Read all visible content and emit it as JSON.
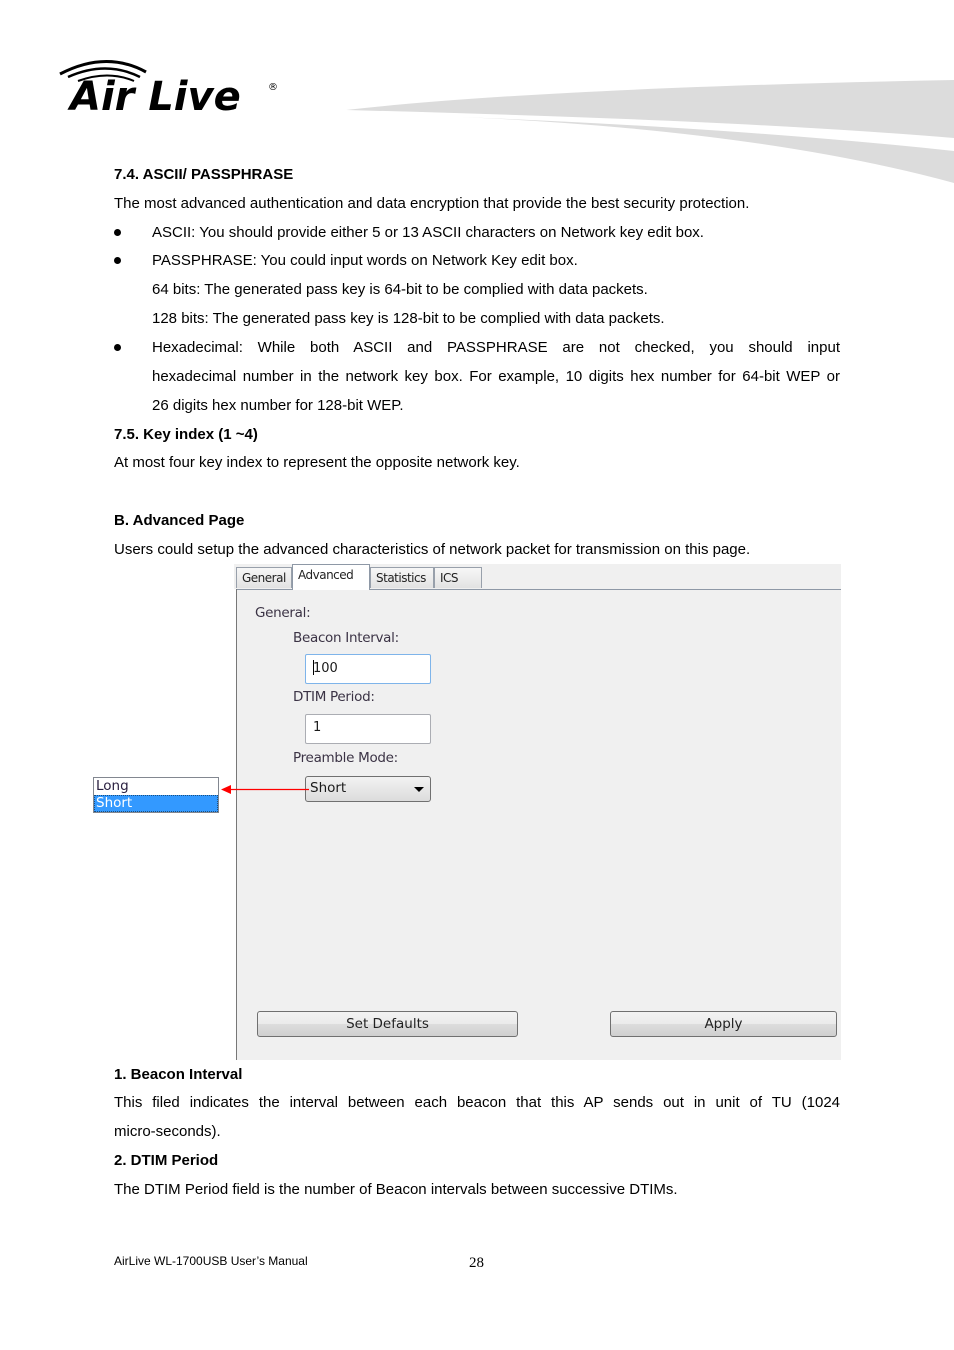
{
  "header": {
    "logo_text": "Air Live",
    "logo_mark": "®"
  },
  "section_7_4": {
    "heading": "7.4. ASCII/ PASSPHRASE",
    "intro": "The most advanced authentication and data encryption that provide the best security protection.",
    "bullets": [
      "ASCII: You should provide either 5 or 13 ASCII characters on Network key edit box.",
      "PASSPHRASE: You could input words on Network Key edit box."
    ],
    "sub_lines": [
      "64 bits: The generated pass key is 64-bit to be complied with data packets.",
      "128 bits: The generated pass key is 128-bit to be complied with data packets."
    ],
    "hex_line1": "Hexadecimal: While both ASCII and PASSPHRASE are not checked, you should input",
    "hex_line2": "hexadecimal number in the network key box. For example, 10 digits hex number for 64-bit WEP or",
    "hex_line3": "26 digits hex number for 128-bit WEP."
  },
  "section_7_5": {
    "heading": "7.5. Key index (1 ~4)",
    "body": "At most four key index to represent the opposite network key."
  },
  "section_b": {
    "heading": "B. Advanced Page",
    "body": "Users could setup the advanced characteristics of network packet for transmission on this page."
  },
  "screenshot": {
    "tabs": [
      {
        "label": "General",
        "active": false
      },
      {
        "label": "Advanced",
        "active": true
      },
      {
        "label": "Statistics",
        "active": false
      },
      {
        "label": "ICS",
        "active": false
      }
    ],
    "group_label": "General:",
    "beacon_label": "Beacon Interval:",
    "beacon_value": "100",
    "dtim_label": "DTIM Period:",
    "dtim_value": "1",
    "preamble_label": "Preamble Mode:",
    "preamble_value": "Short",
    "preamble_options": [
      {
        "label": "Long",
        "selected": false
      },
      {
        "label": "Short",
        "selected": true
      }
    ],
    "set_defaults_label": "Set Defaults",
    "apply_label": "Apply",
    "annotation_arrow_color": "#ff0000",
    "selection_color": "#3399ff"
  },
  "section_1": {
    "heading": "1. Beacon Interval",
    "line1": "This filed indicates the interval between each beacon that this AP sends out in unit of TU (1024",
    "line2": "micro-seconds)."
  },
  "section_2": {
    "heading": "2. DTIM Period",
    "body": "The DTIM Period field is the number of Beacon intervals between successive DTIMs."
  },
  "footer": {
    "manual_title": "AirLive WL-1700USB User’s Manual",
    "page_number": "28"
  }
}
